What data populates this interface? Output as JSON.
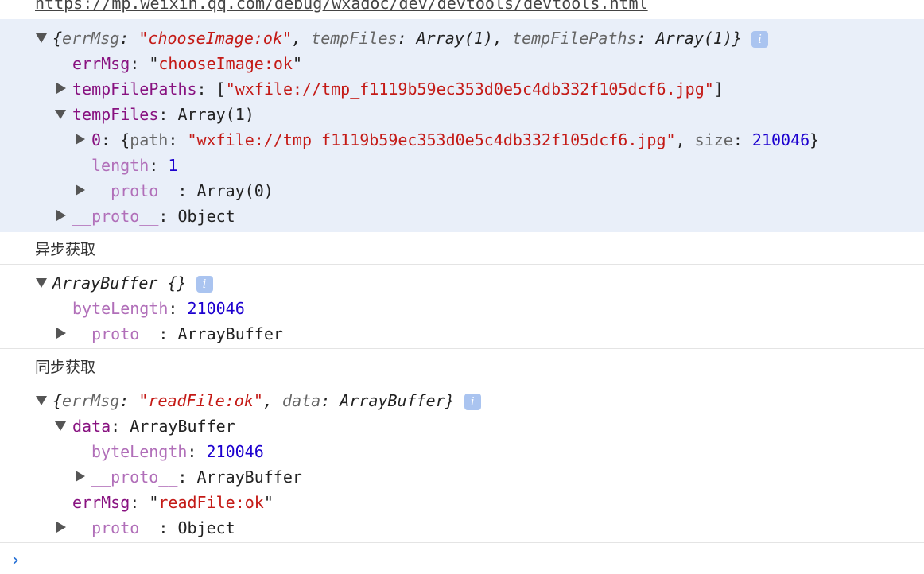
{
  "url": "https://mp.weixin.qq.com/debug/wxadoc/dev/devtools/devtools.html",
  "section_async": "异步获取",
  "section_sync": "同步获取",
  "punct": {
    "colon": ": ",
    "comma": ", ",
    "quote": "\"",
    "lbrace": "{",
    "rbrace": "}",
    "lbracket": "[",
    "rbracket": "]"
  },
  "block1": {
    "summary": {
      "k1": "errMsg",
      "v1": "chooseImage:ok",
      "k2": "tempFiles",
      "v2": "Array(1)",
      "k3": "tempFilePaths",
      "v3": "Array(1)"
    },
    "errMsg": {
      "key": "errMsg",
      "value": "chooseImage:ok"
    },
    "tempFilePaths": {
      "key": "tempFilePaths",
      "value": "wxfile://tmp_f1119b59ec353d0e5c4db332f105dcf6.jpg"
    },
    "tempFiles": {
      "key": "tempFiles",
      "value": "Array(1)"
    },
    "item0": {
      "index": "0",
      "k_path": "path",
      "v_path": "wxfile://tmp_f1119b59ec353d0e5c4db332f105dcf6.jpg",
      "k_size": "size",
      "v_size": "210046"
    },
    "length": {
      "key": "length",
      "value": "1"
    },
    "proto_array": {
      "key": "__proto__",
      "value": "Array(0)"
    },
    "proto_object": {
      "key": "__proto__",
      "value": "Object"
    }
  },
  "block2": {
    "summary": "ArrayBuffer {}",
    "byteLength": {
      "key": "byteLength",
      "value": "210046"
    },
    "proto": {
      "key": "__proto__",
      "value": "ArrayBuffer"
    }
  },
  "block3": {
    "summary": {
      "k1": "errMsg",
      "v1": "readFile:ok",
      "k2": "data",
      "v2": "ArrayBuffer"
    },
    "data": {
      "key": "data",
      "value": "ArrayBuffer"
    },
    "byteLength": {
      "key": "byteLength",
      "value": "210046"
    },
    "proto_ab": {
      "key": "__proto__",
      "value": "ArrayBuffer"
    },
    "errMsg": {
      "key": "errMsg",
      "value": "readFile:ok"
    },
    "proto_object": {
      "key": "__proto__",
      "value": "Object"
    }
  },
  "info_glyph": "i",
  "prompt_glyph": "›"
}
